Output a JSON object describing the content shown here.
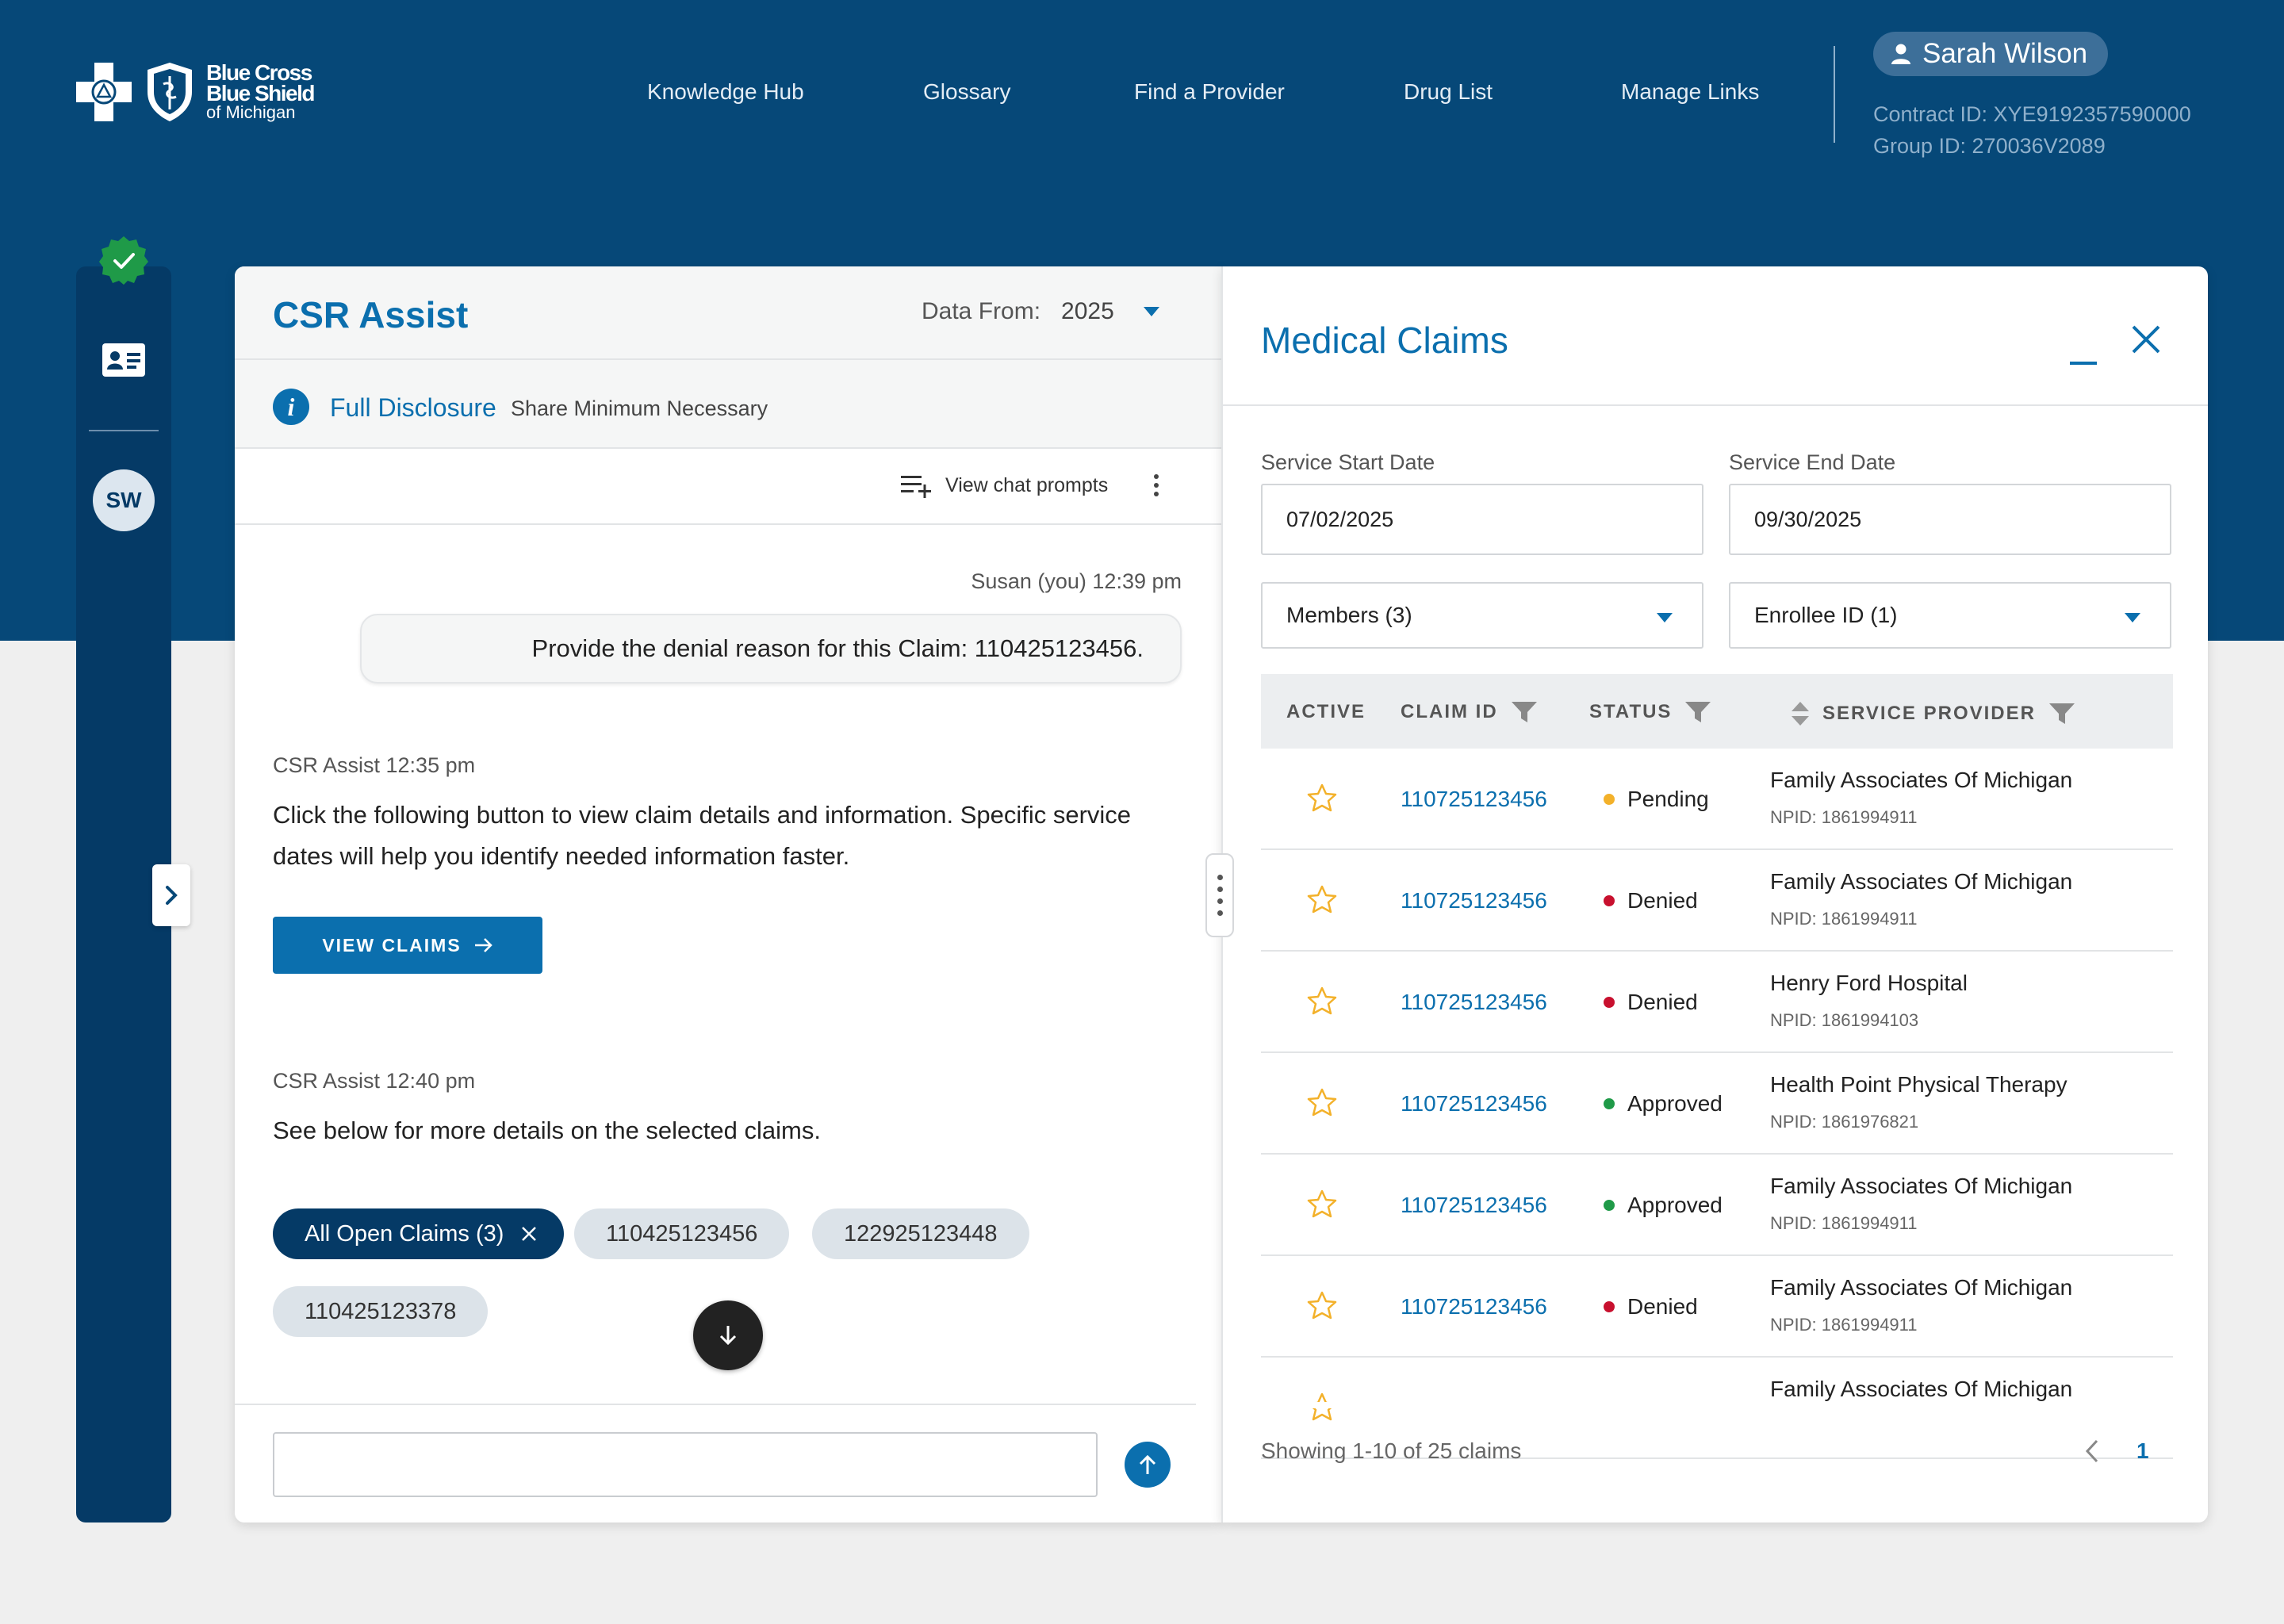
{
  "header": {
    "logo": {
      "line1": "Blue Cross",
      "line2": "Blue Shield",
      "line3": "of Michigan"
    },
    "nav": [
      {
        "label": "Knowledge Hub"
      },
      {
        "label": "Glossary"
      },
      {
        "label": "Find a Provider"
      },
      {
        "label": "Drug List"
      },
      {
        "label": "Manage Links"
      }
    ],
    "user": {
      "name": "Sarah Wilson",
      "contract_id": "Contract ID: XYE9192357590000",
      "group_id": "Group ID: 270036V2089"
    }
  },
  "rail": {
    "avatar_initials": "SW"
  },
  "chat": {
    "title": "CSR Assist",
    "data_from_label": "Data From:",
    "data_from_value": "2025",
    "disclosure_title": "Full Disclosure",
    "disclosure_sub": "Share Minimum Necessary",
    "view_prompts": "View chat prompts",
    "messages": [
      {
        "meta": "Susan (you)  12:39 pm",
        "text": "Provide the denial reason for this Claim: 110425123456."
      },
      {
        "meta": "CSR Assist  12:35 pm",
        "text": "Click the following button to view claim details and information. Specific service dates will help you identify needed information faster."
      },
      {
        "meta": "CSR Assist  12:40 pm",
        "text": "See below for more details on the selected claims."
      }
    ],
    "view_claims_button": "VIEW CLAIMS",
    "chips": [
      {
        "label": "All Open Claims (3)"
      },
      {
        "label": "110425123456"
      },
      {
        "label": "122925123448"
      },
      {
        "label": "110425123378"
      }
    ],
    "input_value": "",
    "input_placeholder": ""
  },
  "claims": {
    "title": "Medical Claims",
    "filters": {
      "start_label": "Service Start Date",
      "start_value": "07/02/2025",
      "end_label": "Service End Date",
      "end_value": "09/30/2025",
      "members": "Members (3)",
      "enrollee": "Enrollee ID (1)"
    },
    "columns": [
      "ACTIVE",
      "CLAIM ID",
      "STATUS",
      "SERVICE PROVIDER"
    ],
    "rows": [
      {
        "claim_id": "110725123456",
        "status": "Pending",
        "status_color": "#f3b12a",
        "provider": "Family Associates Of Michigan",
        "npid": "NPID: 1861994911"
      },
      {
        "claim_id": "110725123456",
        "status": "Denied",
        "status_color": "#c8102e",
        "provider": "Family Associates Of Michigan",
        "npid": "NPID: 1861994911"
      },
      {
        "claim_id": "110725123456",
        "status": "Denied",
        "status_color": "#c8102e",
        "provider": "Henry Ford Hospital",
        "npid": "NPID: 1861994103"
      },
      {
        "claim_id": "110725123456",
        "status": "Approved",
        "status_color": "#1f9a48",
        "provider": "Health Point Physical Therapy",
        "npid": "NPID: 1861976821"
      },
      {
        "claim_id": "110725123456",
        "status": "Approved",
        "status_color": "#1f9a48",
        "provider": "Family Associates Of Michigan",
        "npid": "NPID: 1861994911"
      },
      {
        "claim_id": "110725123456",
        "status": "Denied",
        "status_color": "#c8102e",
        "provider": "Family Associates Of Michigan",
        "npid": "NPID: 1861994911"
      },
      {
        "claim_id": "",
        "status": "",
        "status_color": "#c8102e",
        "provider": "Family Associates Of Michigan",
        "npid": ""
      }
    ],
    "showing": "Showing 1-10 of 25 claims",
    "current_page": "1"
  },
  "colors": {
    "brand_dark": "#064878",
    "brand_blue": "#0b6fae",
    "star": "#f3b12a"
  }
}
